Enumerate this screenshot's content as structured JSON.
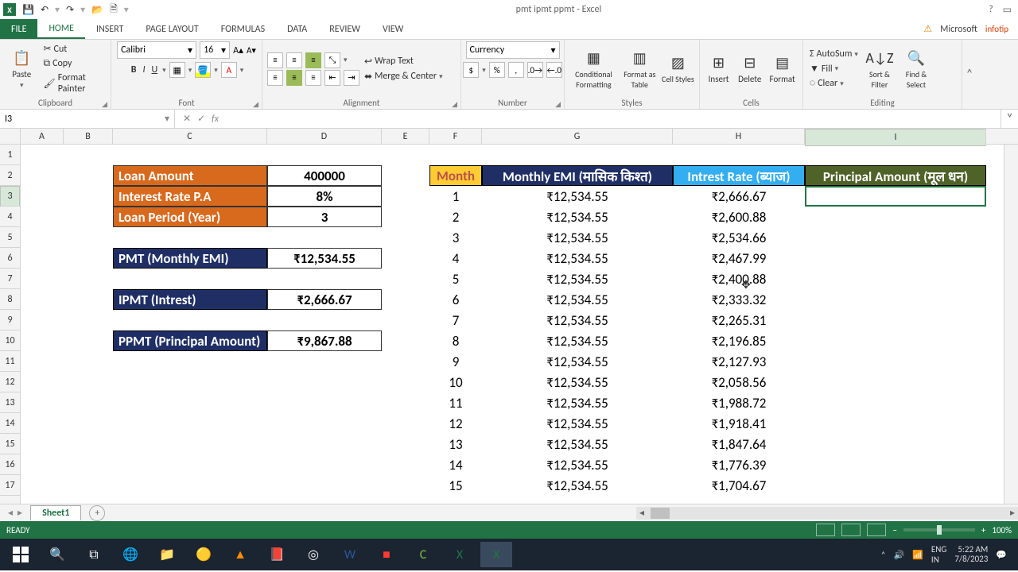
{
  "app": {
    "title": "pmt ipmt ppmt - Excel",
    "help_icon": "?",
    "ribbon_opts_icon": "▭",
    "account": "Microsoft",
    "signature": "infotip"
  },
  "qat": {
    "save": "💾",
    "undo": "↶",
    "redo": "↷",
    "open": "📂",
    "new": "🗎"
  },
  "tabs": {
    "file": "FILE",
    "home": "HOME",
    "insert": "INSERT",
    "pagelayout": "PAGE LAYOUT",
    "formulas": "FORMULAS",
    "data": "DATA",
    "review": "REVIEW",
    "view": "VIEW"
  },
  "ribbon": {
    "clipboard": {
      "label": "Clipboard",
      "paste": "Paste",
      "cut": "Cut",
      "copy": "Copy",
      "painter": "Format Painter"
    },
    "font": {
      "label": "Font",
      "name": "Calibri",
      "size": "16",
      "bold": "B",
      "italic": "I",
      "underline": "U"
    },
    "alignment": {
      "label": "Alignment",
      "wrap": "Wrap Text",
      "merge": "Merge & Center"
    },
    "number": {
      "label": "Number",
      "format": "Currency"
    },
    "styles": {
      "label": "Styles",
      "cond": "Conditional Formatting",
      "table": "Format as Table",
      "cell": "Cell Styles"
    },
    "cells": {
      "label": "Cells",
      "insert": "Insert",
      "delete": "Delete",
      "format": "Format"
    },
    "editing": {
      "label": "Editing",
      "sum": "AutoSum",
      "fill": "Fill",
      "clear": "Clear",
      "sort": "Sort & Filter",
      "find": "Find & Select"
    }
  },
  "fx": {
    "namebox": "I3",
    "formula": ""
  },
  "cols": [
    "A",
    "B",
    "C",
    "D",
    "E",
    "F",
    "G",
    "H",
    "I"
  ],
  "loan": {
    "amount_label": "Loan Amount",
    "amount": "400000",
    "rate_label": "Interest Rate P.A",
    "rate": "8%",
    "period_label": "Loan Period (Year)",
    "period": "3",
    "pmt_label": "PMT (Monthly EMI)",
    "pmt": "₹12,534.55",
    "ipmt_label": "IPMT (Intrest)",
    "ipmt": "₹2,666.67",
    "ppmt_label": "PPMT (Principal Amount)",
    "ppmt": "₹9,867.88"
  },
  "table": {
    "month": "Month",
    "emi": "Monthly EMI (मासिक किश्त)",
    "intrest": "Intrest Rate (ब्याज)",
    "principal": "Principal Amount (मूल धन)",
    "rows": [
      {
        "m": "1",
        "emi": "₹12,534.55",
        "int": "₹2,666.67"
      },
      {
        "m": "2",
        "emi": "₹12,534.55",
        "int": "₹2,600.88"
      },
      {
        "m": "3",
        "emi": "₹12,534.55",
        "int": "₹2,534.66"
      },
      {
        "m": "4",
        "emi": "₹12,534.55",
        "int": "₹2,467.99"
      },
      {
        "m": "5",
        "emi": "₹12,534.55",
        "int": "₹2,400.88"
      },
      {
        "m": "6",
        "emi": "₹12,534.55",
        "int": "₹2,333.32"
      },
      {
        "m": "7",
        "emi": "₹12,534.55",
        "int": "₹2,265.31"
      },
      {
        "m": "8",
        "emi": "₹12,534.55",
        "int": "₹2,196.85"
      },
      {
        "m": "9",
        "emi": "₹12,534.55",
        "int": "₹2,127.93"
      },
      {
        "m": "10",
        "emi": "₹12,534.55",
        "int": "₹2,058.56"
      },
      {
        "m": "11",
        "emi": "₹12,534.55",
        "int": "₹1,988.72"
      },
      {
        "m": "12",
        "emi": "₹12,534.55",
        "int": "₹1,918.41"
      },
      {
        "m": "13",
        "emi": "₹12,534.55",
        "int": "₹1,847.64"
      },
      {
        "m": "14",
        "emi": "₹12,534.55",
        "int": "₹1,776.39"
      },
      {
        "m": "15",
        "emi": "₹12,534.55",
        "int": "₹1,704.67"
      }
    ]
  },
  "sheettab": "Sheet1",
  "status": {
    "ready": "READY",
    "zoom": "100%"
  },
  "tray": {
    "lang1": "ENG",
    "lang2": "IN",
    "time": "5:22 AM",
    "date": "7/8/2023"
  }
}
